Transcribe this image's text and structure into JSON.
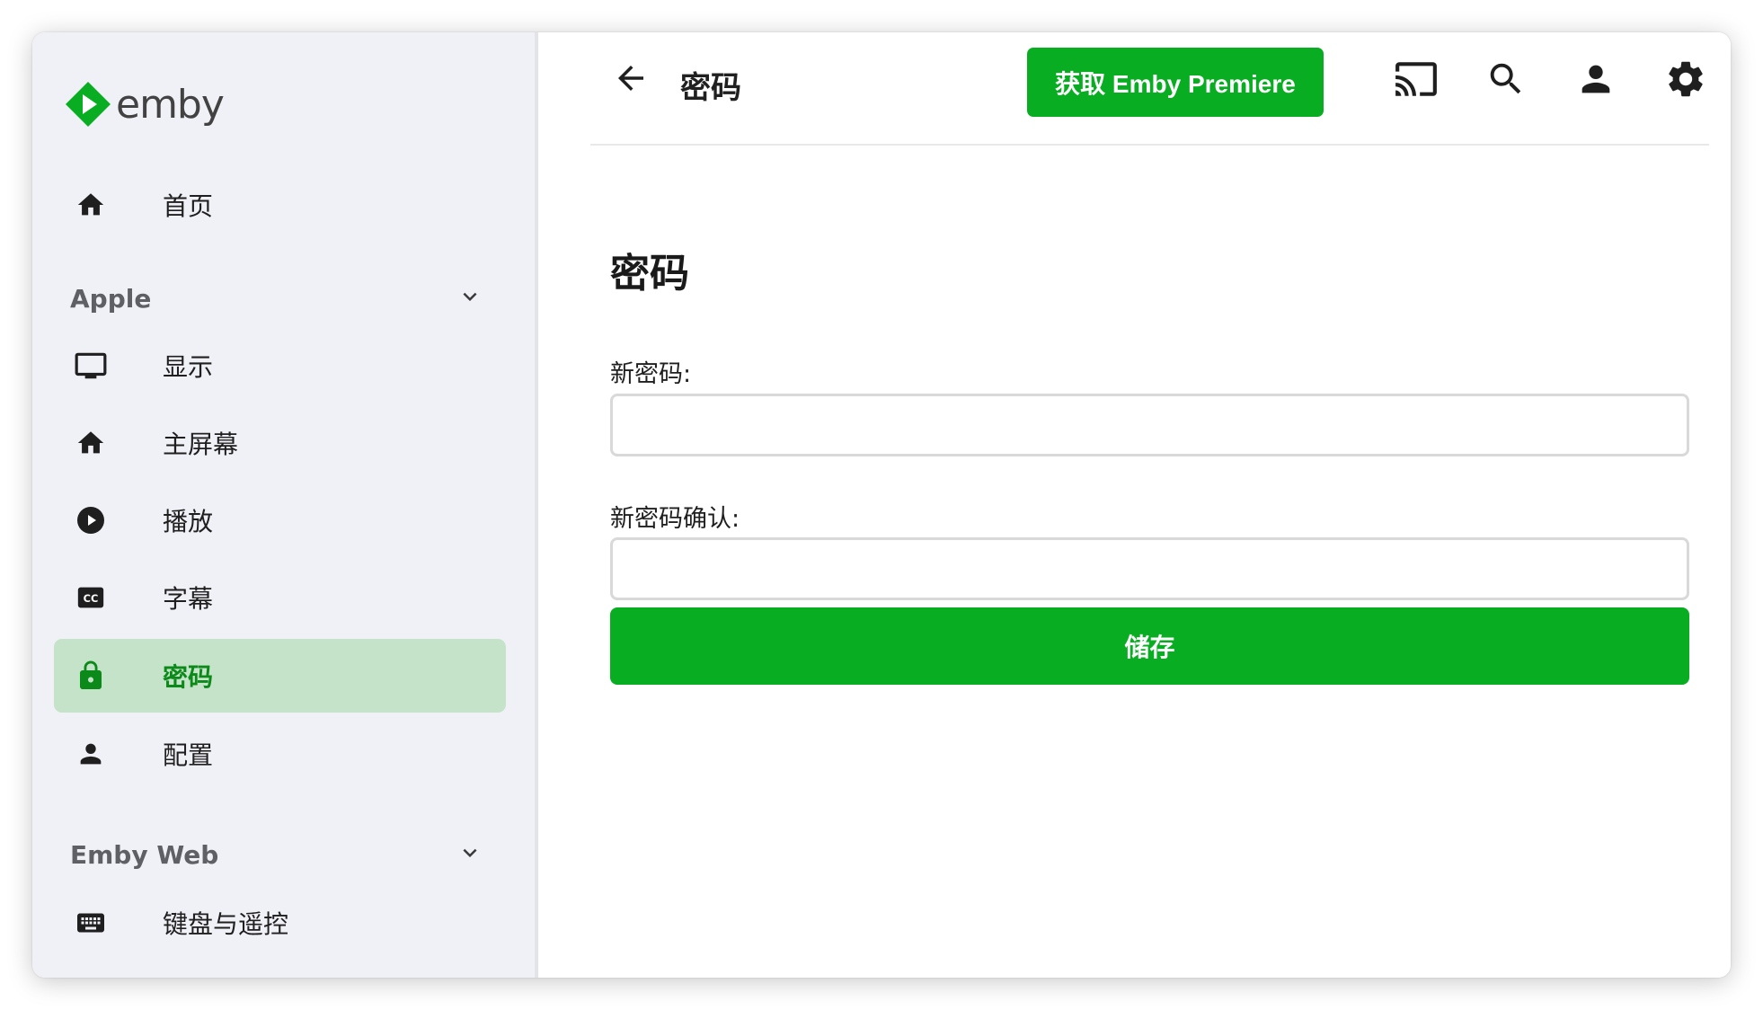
{
  "app": {
    "logo_text": "emby",
    "brand_color": "#08ad22"
  },
  "sidebar": {
    "home_label": "首页",
    "sections": [
      {
        "title": "Apple",
        "items": [
          {
            "label": "显示",
            "icon": "monitor-icon"
          },
          {
            "label": "主屏幕",
            "icon": "home-icon"
          },
          {
            "label": "播放",
            "icon": "play-circle-icon"
          },
          {
            "label": "字幕",
            "icon": "closed-caption-icon"
          },
          {
            "label": "密码",
            "icon": "lock-icon",
            "active": true
          },
          {
            "label": "配置",
            "icon": "person-icon"
          }
        ]
      },
      {
        "title": "Emby Web",
        "items": [
          {
            "label": "键盘与遥控",
            "icon": "keyboard-icon"
          }
        ]
      }
    ]
  },
  "header": {
    "title": "密码",
    "premiere_button": "获取 Emby Premiere",
    "icons": [
      "cast-icon",
      "search-icon",
      "user-icon",
      "settings-gear-icon"
    ]
  },
  "page": {
    "title": "密码",
    "new_password_label": "新密码:",
    "new_password_value": "",
    "confirm_password_label": "新密码确认:",
    "confirm_password_value": "",
    "save_label": "储存"
  }
}
